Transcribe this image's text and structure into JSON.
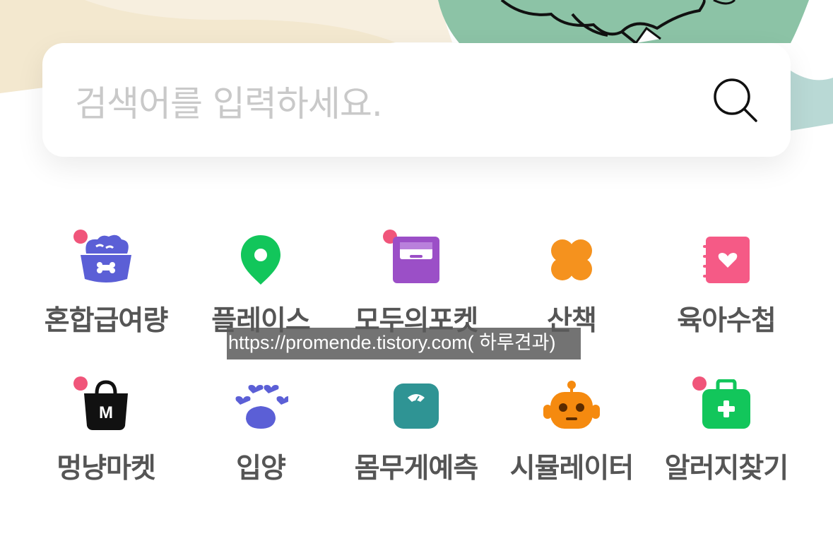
{
  "search": {
    "placeholder": "검색어를 입력하세요."
  },
  "menu": {
    "row1": [
      {
        "label": "혼합급여량",
        "icon": "food-bowl-icon",
        "badge": true
      },
      {
        "label": "플레이스",
        "icon": "map-pin-icon",
        "badge": false
      },
      {
        "label": "모두의포켓",
        "icon": "inbox-tray-icon",
        "badge": true
      },
      {
        "label": "산책",
        "icon": "clover-icon",
        "badge": false
      },
      {
        "label": "육아수첩",
        "icon": "notebook-heart-icon",
        "badge": false
      }
    ],
    "row2": [
      {
        "label": "멍냥마켓",
        "icon": "shopping-bag-icon",
        "badge": true
      },
      {
        "label": "입양",
        "icon": "paw-icon",
        "badge": false
      },
      {
        "label": "몸무게예측",
        "icon": "scale-icon",
        "badge": false
      },
      {
        "label": "시뮬레이터",
        "icon": "robot-icon",
        "badge": false
      },
      {
        "label": "알러지찾기",
        "icon": "first-aid-kit-icon",
        "badge": true
      }
    ]
  },
  "watermark": {
    "text": "https://promende.tistory.com( 하루견과)"
  },
  "colors": {
    "badge": "#f0557a",
    "bowl": "#5b5fd6",
    "pin": "#12c65b",
    "tray": "#9b4fc7",
    "clover": "#f5921e",
    "notebook": "#f55a86",
    "bag": "#111111",
    "paw": "#5b5fd6",
    "scale": "#2f9494",
    "robot": "#f58a0f",
    "kit": "#12c65b"
  }
}
